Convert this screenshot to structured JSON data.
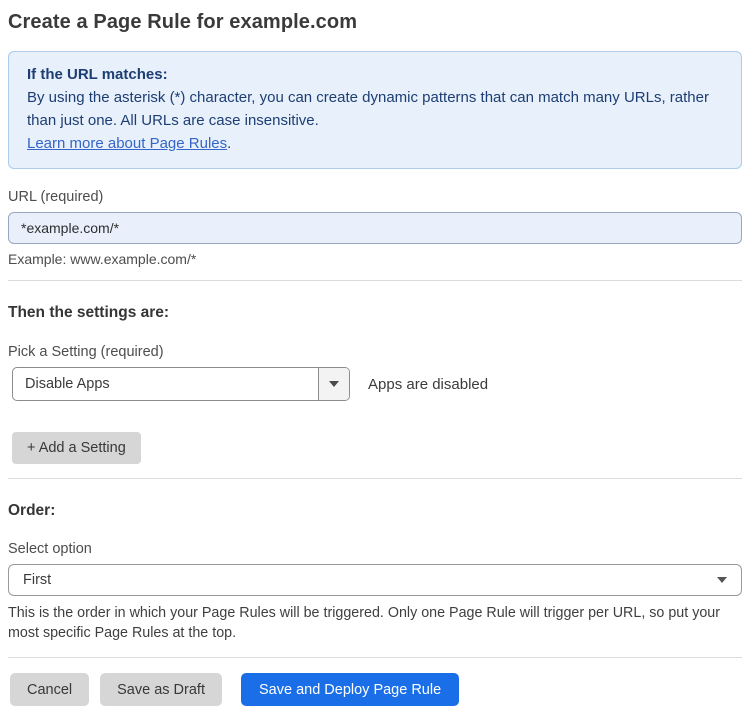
{
  "page": {
    "title": "Create a Page Rule for example.com"
  },
  "info_box": {
    "heading": "If the URL matches:",
    "body": "By using the asterisk (*) character, you can create dynamic patterns that can match many URLs, rather than just one. All URLs are case insensitive.",
    "link_label": "Learn more about Page Rules",
    "link_suffix": "."
  },
  "url_field": {
    "label": "URL (required)",
    "value": "*example.com/*",
    "hint": "Example: www.example.com/*"
  },
  "settings_section": {
    "heading": "Then the settings are:",
    "picker_label": "Pick a Setting (required)",
    "selected_setting": "Disable Apps",
    "setting_status": "Apps are disabled",
    "add_setting_label": "+ Add a Setting"
  },
  "order_section": {
    "heading": "Order:",
    "select_label": "Select option",
    "selected_option": "First",
    "help_text": "This is the order in which your Page Rules will be triggered. Only one Page Rule will trigger per URL, so put your most specific Page Rules at the top."
  },
  "footer": {
    "cancel_label": "Cancel",
    "save_draft_label": "Save as Draft",
    "save_deploy_label": "Save and Deploy Page Rule"
  },
  "colors": {
    "info_box_bg": "#e7f0fb",
    "info_box_border": "#accce9",
    "info_text": "#1d3e73",
    "link_blue": "#3565c6",
    "input_bg": "#e9f0fc",
    "primary_button_bg": "#1a6fe8",
    "secondary_button_bg": "#d6d6d6"
  },
  "icons": {
    "dropdown_caret": "caret-down"
  }
}
